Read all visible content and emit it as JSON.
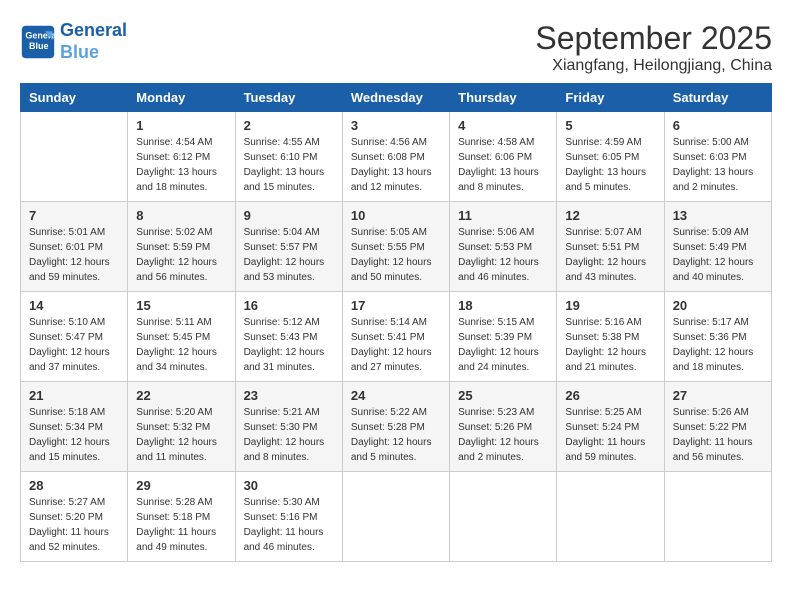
{
  "header": {
    "logo_line1": "General",
    "logo_line2": "Blue",
    "title": "September 2025",
    "subtitle": "Xiangfang, Heilongjiang, China"
  },
  "columns": [
    "Sunday",
    "Monday",
    "Tuesday",
    "Wednesday",
    "Thursday",
    "Friday",
    "Saturday"
  ],
  "weeks": [
    [
      {
        "day": "",
        "info": ""
      },
      {
        "day": "1",
        "info": "Sunrise: 4:54 AM\nSunset: 6:12 PM\nDaylight: 13 hours\nand 18 minutes."
      },
      {
        "day": "2",
        "info": "Sunrise: 4:55 AM\nSunset: 6:10 PM\nDaylight: 13 hours\nand 15 minutes."
      },
      {
        "day": "3",
        "info": "Sunrise: 4:56 AM\nSunset: 6:08 PM\nDaylight: 13 hours\nand 12 minutes."
      },
      {
        "day": "4",
        "info": "Sunrise: 4:58 AM\nSunset: 6:06 PM\nDaylight: 13 hours\nand 8 minutes."
      },
      {
        "day": "5",
        "info": "Sunrise: 4:59 AM\nSunset: 6:05 PM\nDaylight: 13 hours\nand 5 minutes."
      },
      {
        "day": "6",
        "info": "Sunrise: 5:00 AM\nSunset: 6:03 PM\nDaylight: 13 hours\nand 2 minutes."
      }
    ],
    [
      {
        "day": "7",
        "info": "Sunrise: 5:01 AM\nSunset: 6:01 PM\nDaylight: 12 hours\nand 59 minutes."
      },
      {
        "day": "8",
        "info": "Sunrise: 5:02 AM\nSunset: 5:59 PM\nDaylight: 12 hours\nand 56 minutes."
      },
      {
        "day": "9",
        "info": "Sunrise: 5:04 AM\nSunset: 5:57 PM\nDaylight: 12 hours\nand 53 minutes."
      },
      {
        "day": "10",
        "info": "Sunrise: 5:05 AM\nSunset: 5:55 PM\nDaylight: 12 hours\nand 50 minutes."
      },
      {
        "day": "11",
        "info": "Sunrise: 5:06 AM\nSunset: 5:53 PM\nDaylight: 12 hours\nand 46 minutes."
      },
      {
        "day": "12",
        "info": "Sunrise: 5:07 AM\nSunset: 5:51 PM\nDaylight: 12 hours\nand 43 minutes."
      },
      {
        "day": "13",
        "info": "Sunrise: 5:09 AM\nSunset: 5:49 PM\nDaylight: 12 hours\nand 40 minutes."
      }
    ],
    [
      {
        "day": "14",
        "info": "Sunrise: 5:10 AM\nSunset: 5:47 PM\nDaylight: 12 hours\nand 37 minutes."
      },
      {
        "day": "15",
        "info": "Sunrise: 5:11 AM\nSunset: 5:45 PM\nDaylight: 12 hours\nand 34 minutes."
      },
      {
        "day": "16",
        "info": "Sunrise: 5:12 AM\nSunset: 5:43 PM\nDaylight: 12 hours\nand 31 minutes."
      },
      {
        "day": "17",
        "info": "Sunrise: 5:14 AM\nSunset: 5:41 PM\nDaylight: 12 hours\nand 27 minutes."
      },
      {
        "day": "18",
        "info": "Sunrise: 5:15 AM\nSunset: 5:39 PM\nDaylight: 12 hours\nand 24 minutes."
      },
      {
        "day": "19",
        "info": "Sunrise: 5:16 AM\nSunset: 5:38 PM\nDaylight: 12 hours\nand 21 minutes."
      },
      {
        "day": "20",
        "info": "Sunrise: 5:17 AM\nSunset: 5:36 PM\nDaylight: 12 hours\nand 18 minutes."
      }
    ],
    [
      {
        "day": "21",
        "info": "Sunrise: 5:18 AM\nSunset: 5:34 PM\nDaylight: 12 hours\nand 15 minutes."
      },
      {
        "day": "22",
        "info": "Sunrise: 5:20 AM\nSunset: 5:32 PM\nDaylight: 12 hours\nand 11 minutes."
      },
      {
        "day": "23",
        "info": "Sunrise: 5:21 AM\nSunset: 5:30 PM\nDaylight: 12 hours\nand 8 minutes."
      },
      {
        "day": "24",
        "info": "Sunrise: 5:22 AM\nSunset: 5:28 PM\nDaylight: 12 hours\nand 5 minutes."
      },
      {
        "day": "25",
        "info": "Sunrise: 5:23 AM\nSunset: 5:26 PM\nDaylight: 12 hours\nand 2 minutes."
      },
      {
        "day": "26",
        "info": "Sunrise: 5:25 AM\nSunset: 5:24 PM\nDaylight: 11 hours\nand 59 minutes."
      },
      {
        "day": "27",
        "info": "Sunrise: 5:26 AM\nSunset: 5:22 PM\nDaylight: 11 hours\nand 56 minutes."
      }
    ],
    [
      {
        "day": "28",
        "info": "Sunrise: 5:27 AM\nSunset: 5:20 PM\nDaylight: 11 hours\nand 52 minutes."
      },
      {
        "day": "29",
        "info": "Sunrise: 5:28 AM\nSunset: 5:18 PM\nDaylight: 11 hours\nand 49 minutes."
      },
      {
        "day": "30",
        "info": "Sunrise: 5:30 AM\nSunset: 5:16 PM\nDaylight: 11 hours\nand 46 minutes."
      },
      {
        "day": "",
        "info": ""
      },
      {
        "day": "",
        "info": ""
      },
      {
        "day": "",
        "info": ""
      },
      {
        "day": "",
        "info": ""
      }
    ]
  ]
}
